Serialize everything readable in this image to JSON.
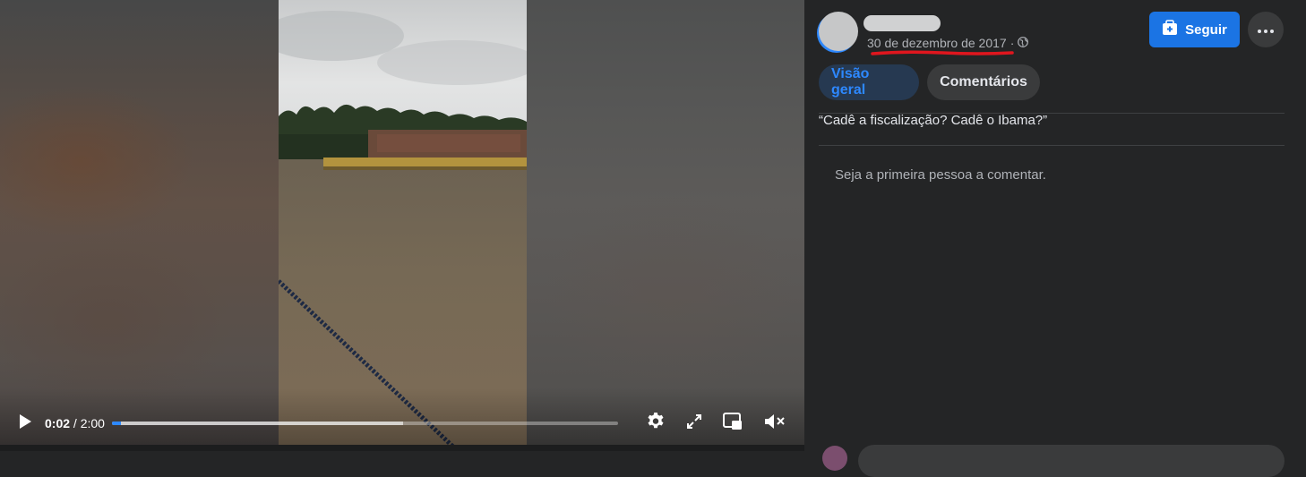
{
  "video": {
    "current_time": "0:02",
    "separator": " / ",
    "duration": "2:00",
    "progress_played": 0.017,
    "progress_buffered": 0.575,
    "controls": {
      "play_icon": "play-icon",
      "settings_icon": "gear-icon",
      "fullscreen_icon": "expand-icon",
      "pip_icon": "picture-in-picture-icon",
      "mute_icon": "muted-speaker-icon"
    }
  },
  "post": {
    "date": "30 de dezembro de 2017",
    "meta_separator": "·",
    "privacy_icon": "globe-icon",
    "follow_label": "Seguir",
    "follow_icon": "add-page-icon",
    "more_icon": "more-dots-icon",
    "caption": "“Cadê a fiscalização? Cadê o Ibama?”"
  },
  "tabs": [
    {
      "label": "Visão geral",
      "active": true
    },
    {
      "label": "Comentários",
      "active": false
    }
  ],
  "comments": {
    "empty_text": "Seja a primeira pessoa a comentar."
  },
  "colors": {
    "accent": "#1b74e4",
    "active_tab_text": "#2d88ff",
    "annotation_underline": "#e0161e",
    "panel_bg": "#242526"
  }
}
